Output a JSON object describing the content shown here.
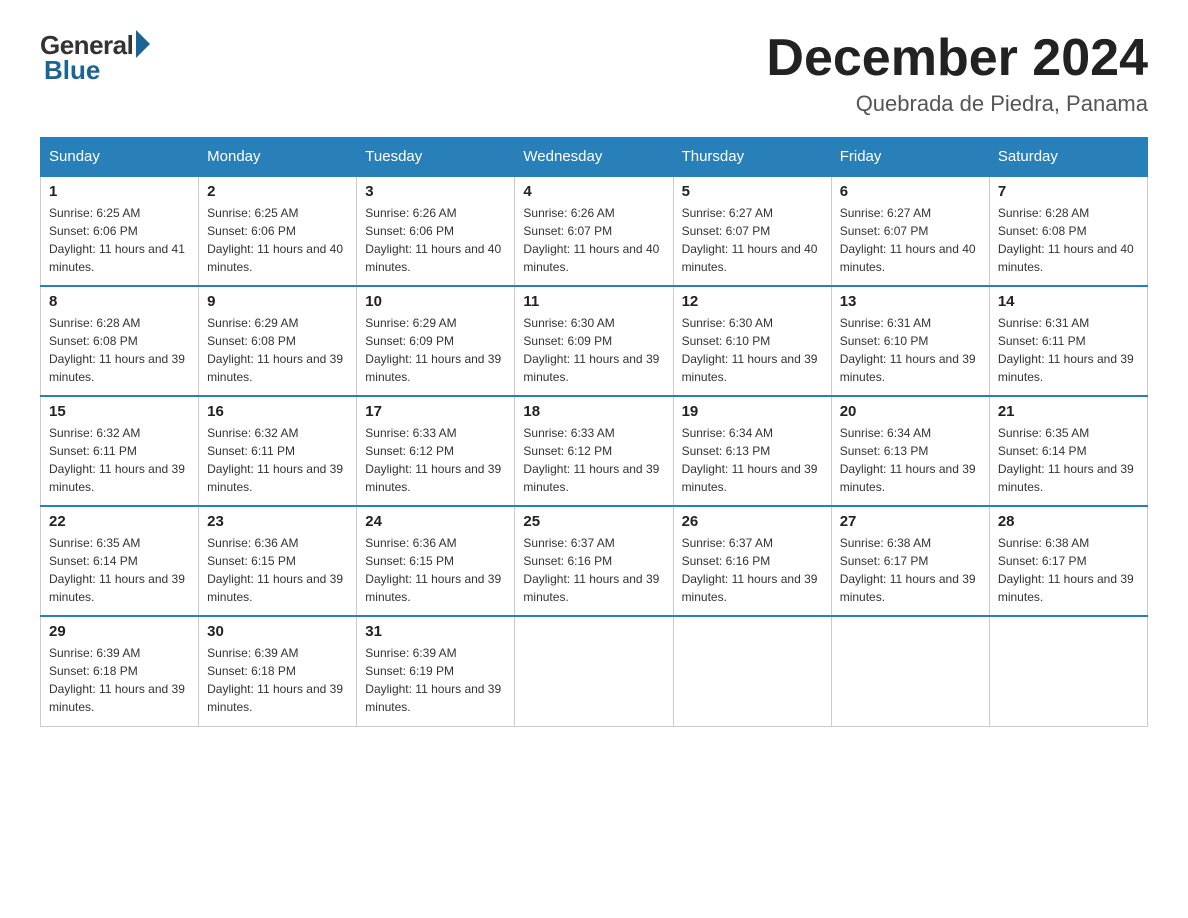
{
  "header": {
    "logo_general": "General",
    "logo_blue": "Blue",
    "month_title": "December 2024",
    "location": "Quebrada de Piedra, Panama"
  },
  "days_of_week": [
    "Sunday",
    "Monday",
    "Tuesday",
    "Wednesday",
    "Thursday",
    "Friday",
    "Saturday"
  ],
  "weeks": [
    [
      {
        "day": "1",
        "sunrise": "6:25 AM",
        "sunset": "6:06 PM",
        "daylight": "11 hours and 41 minutes."
      },
      {
        "day": "2",
        "sunrise": "6:25 AM",
        "sunset": "6:06 PM",
        "daylight": "11 hours and 40 minutes."
      },
      {
        "day": "3",
        "sunrise": "6:26 AM",
        "sunset": "6:06 PM",
        "daylight": "11 hours and 40 minutes."
      },
      {
        "day": "4",
        "sunrise": "6:26 AM",
        "sunset": "6:07 PM",
        "daylight": "11 hours and 40 minutes."
      },
      {
        "day": "5",
        "sunrise": "6:27 AM",
        "sunset": "6:07 PM",
        "daylight": "11 hours and 40 minutes."
      },
      {
        "day": "6",
        "sunrise": "6:27 AM",
        "sunset": "6:07 PM",
        "daylight": "11 hours and 40 minutes."
      },
      {
        "day": "7",
        "sunrise": "6:28 AM",
        "sunset": "6:08 PM",
        "daylight": "11 hours and 40 minutes."
      }
    ],
    [
      {
        "day": "8",
        "sunrise": "6:28 AM",
        "sunset": "6:08 PM",
        "daylight": "11 hours and 39 minutes."
      },
      {
        "day": "9",
        "sunrise": "6:29 AM",
        "sunset": "6:08 PM",
        "daylight": "11 hours and 39 minutes."
      },
      {
        "day": "10",
        "sunrise": "6:29 AM",
        "sunset": "6:09 PM",
        "daylight": "11 hours and 39 minutes."
      },
      {
        "day": "11",
        "sunrise": "6:30 AM",
        "sunset": "6:09 PM",
        "daylight": "11 hours and 39 minutes."
      },
      {
        "day": "12",
        "sunrise": "6:30 AM",
        "sunset": "6:10 PM",
        "daylight": "11 hours and 39 minutes."
      },
      {
        "day": "13",
        "sunrise": "6:31 AM",
        "sunset": "6:10 PM",
        "daylight": "11 hours and 39 minutes."
      },
      {
        "day": "14",
        "sunrise": "6:31 AM",
        "sunset": "6:11 PM",
        "daylight": "11 hours and 39 minutes."
      }
    ],
    [
      {
        "day": "15",
        "sunrise": "6:32 AM",
        "sunset": "6:11 PM",
        "daylight": "11 hours and 39 minutes."
      },
      {
        "day": "16",
        "sunrise": "6:32 AM",
        "sunset": "6:11 PM",
        "daylight": "11 hours and 39 minutes."
      },
      {
        "day": "17",
        "sunrise": "6:33 AM",
        "sunset": "6:12 PM",
        "daylight": "11 hours and 39 minutes."
      },
      {
        "day": "18",
        "sunrise": "6:33 AM",
        "sunset": "6:12 PM",
        "daylight": "11 hours and 39 minutes."
      },
      {
        "day": "19",
        "sunrise": "6:34 AM",
        "sunset": "6:13 PM",
        "daylight": "11 hours and 39 minutes."
      },
      {
        "day": "20",
        "sunrise": "6:34 AM",
        "sunset": "6:13 PM",
        "daylight": "11 hours and 39 minutes."
      },
      {
        "day": "21",
        "sunrise": "6:35 AM",
        "sunset": "6:14 PM",
        "daylight": "11 hours and 39 minutes."
      }
    ],
    [
      {
        "day": "22",
        "sunrise": "6:35 AM",
        "sunset": "6:14 PM",
        "daylight": "11 hours and 39 minutes."
      },
      {
        "day": "23",
        "sunrise": "6:36 AM",
        "sunset": "6:15 PM",
        "daylight": "11 hours and 39 minutes."
      },
      {
        "day": "24",
        "sunrise": "6:36 AM",
        "sunset": "6:15 PM",
        "daylight": "11 hours and 39 minutes."
      },
      {
        "day": "25",
        "sunrise": "6:37 AM",
        "sunset": "6:16 PM",
        "daylight": "11 hours and 39 minutes."
      },
      {
        "day": "26",
        "sunrise": "6:37 AM",
        "sunset": "6:16 PM",
        "daylight": "11 hours and 39 minutes."
      },
      {
        "day": "27",
        "sunrise": "6:38 AM",
        "sunset": "6:17 PM",
        "daylight": "11 hours and 39 minutes."
      },
      {
        "day": "28",
        "sunrise": "6:38 AM",
        "sunset": "6:17 PM",
        "daylight": "11 hours and 39 minutes."
      }
    ],
    [
      {
        "day": "29",
        "sunrise": "6:39 AM",
        "sunset": "6:18 PM",
        "daylight": "11 hours and 39 minutes."
      },
      {
        "day": "30",
        "sunrise": "6:39 AM",
        "sunset": "6:18 PM",
        "daylight": "11 hours and 39 minutes."
      },
      {
        "day": "31",
        "sunrise": "6:39 AM",
        "sunset": "6:19 PM",
        "daylight": "11 hours and 39 minutes."
      },
      null,
      null,
      null,
      null
    ]
  ]
}
